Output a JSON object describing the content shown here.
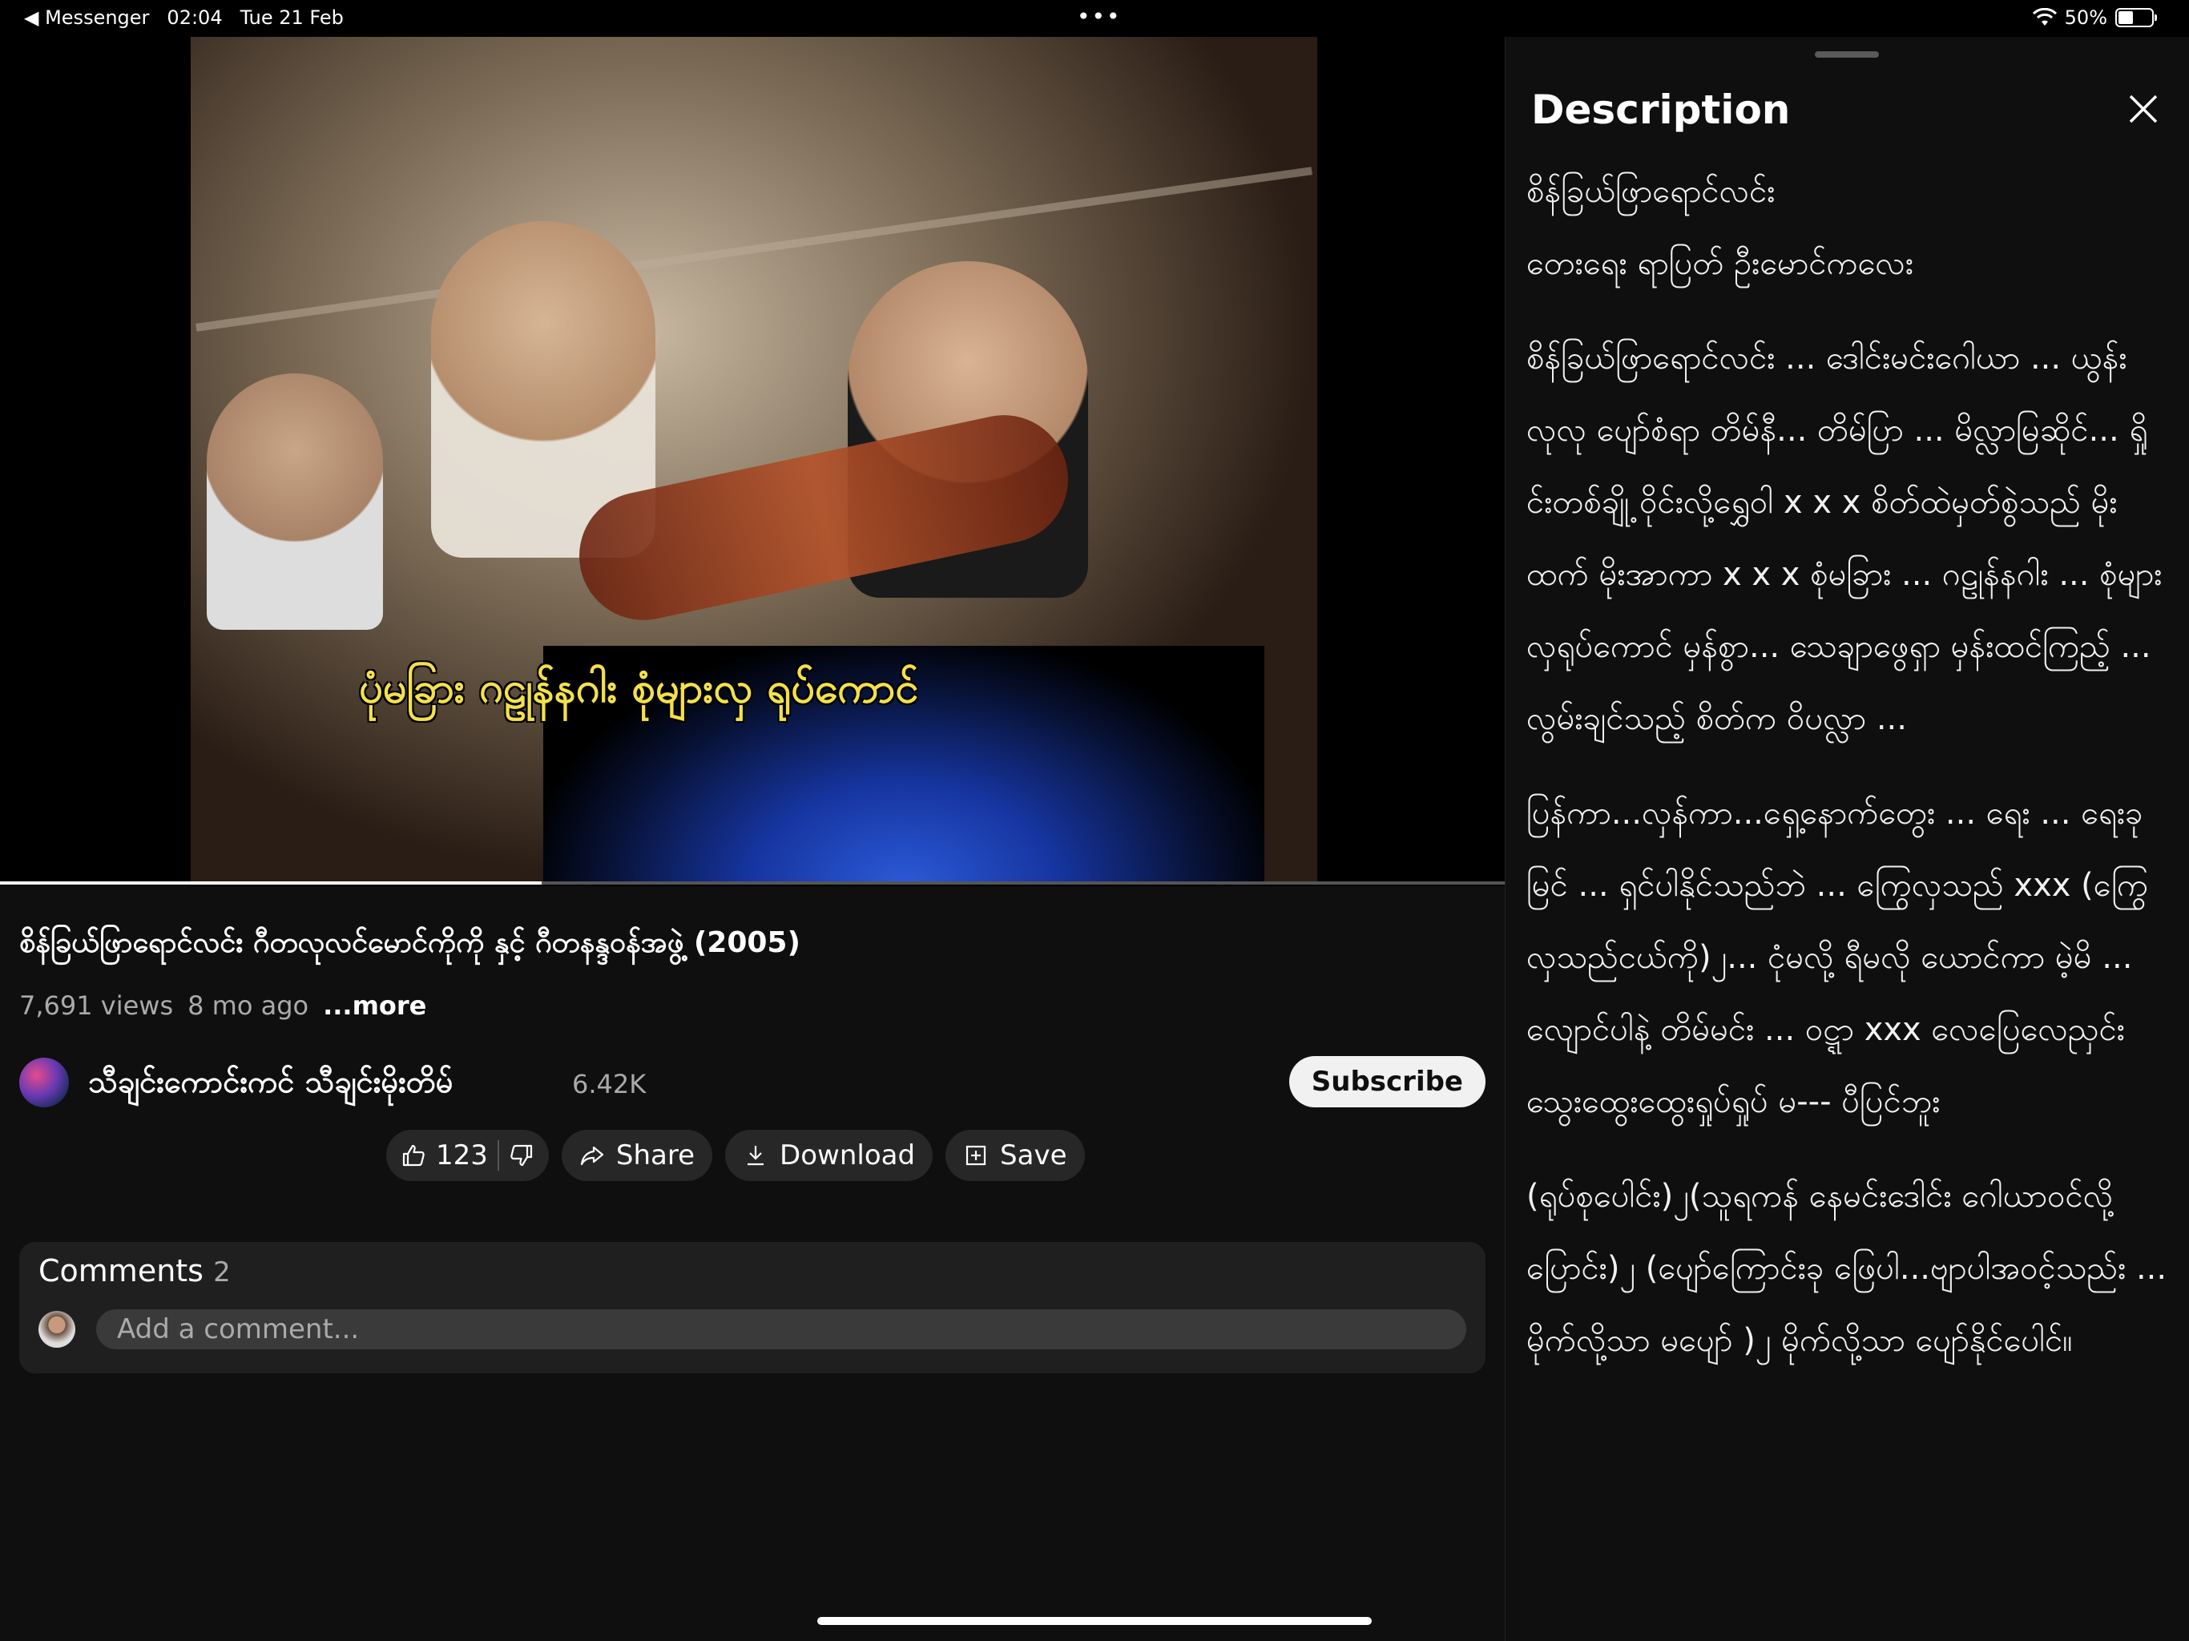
{
  "status_bar": {
    "back_app": "◀ Messenger",
    "time": "02:04",
    "date": "Tue 21 Feb",
    "dots": "•••",
    "battery_pct": "50%",
    "battery_level": 0.5
  },
  "player": {
    "subtitle_overlay": "ပုံမခြား ဂဠုန်နဂါး စုံများလှ ရုပ်ကောင်",
    "progress": 0.36
  },
  "video": {
    "title": "စိန်ခြယ်ဖြာရောင်လင်း ဂီတလုလင်မောင်ကိုကို နှင့် ဂီတနန္ဒဝန်အဖွဲ့ (2005)",
    "views": "7,691 views",
    "age": "8 mo ago",
    "more": "...more"
  },
  "channel": {
    "name": "သီချင်းကောင်းကင် သီချင်းမိုးတိမ်",
    "subscribers": "6.42K",
    "subscribe_label": "Subscribe"
  },
  "actions": {
    "likes": "123",
    "share": "Share",
    "download": "Download",
    "save": "Save"
  },
  "comments": {
    "label": "Comments",
    "count": "2",
    "placeholder": "Add a comment..."
  },
  "description": {
    "title": "Description",
    "lines": [
      "စိန်ခြယ်ဖြာရောင်လင်း",
      "တေးရေး ရာပြတ် ဦးမောင်ကလေး",
      "စိန်ခြယ်ဖြာရောင်လင်း ... ဒေါင်းမင်းဂေါယာ ... ယွန်းလုလု ပျော်စံရာ တိမ်နီ... တိမ်ပြာ ... မိလ္လာမြဆိုင်... ရှိုင်းတစ်ချို့ ဝိုင်းလို့ရွှေဝါ x x x စိတ်ထဲမှတ်စွဲသည် မိုးထက် မိုးအာကာ x x x စုံမခြား ... ဂဠုန်နဂါး ... စုံများလှရုပ်ကောင် မှန်စွာ... သေချာဖွေရှာ မှန်းထင်ကြည့် ... လွမ်းချင်သည့် စိတ်က ဝိပလ္လာ ...",
      "ပြန်ကာ...လှန်ကာ...ရှေ့နောက်တွေး ... ရေး ... ရေးခုမြင် ... ရှင်ပါနိုင်သည်ဘဲ ... ကြွေလှသည် xxx (ကြွေလှသည်ငယ်ကို)၂... ငုံမလို့ ရီမလို ယောင်ကာ မဲ့မိ ... လျောင်ပါနဲ့ တိမ်မင်း ... ဝဋ္ဋာ xxx လေပြေလေညှင်း သွေးထွေးထွေးရှုပ်ရှုပ် မ--- ပီပြင်ဘူး",
      "(ရုပ်စုပေါင်း)၂(သူရကန် နေမင်းဒေါင်း ဂေါယာဝင်လို့ပြောင်း)၂ (ပျော်ကြောင်းခု ဖြေပါ...ဗျာပါအဝင့်သည်း ... မိုက်လို့သာ မပျော် )၂ မိုက်လို့သာ ပျော်နိုင်ပေါင်။"
    ]
  },
  "icons": {
    "like": "thumbs-up-icon",
    "dislike": "thumbs-down-icon",
    "share": "share-icon",
    "download": "download-icon",
    "save": "save-playlist-icon",
    "close": "close-icon",
    "wifi": "wifi-icon",
    "battery": "battery-icon"
  }
}
